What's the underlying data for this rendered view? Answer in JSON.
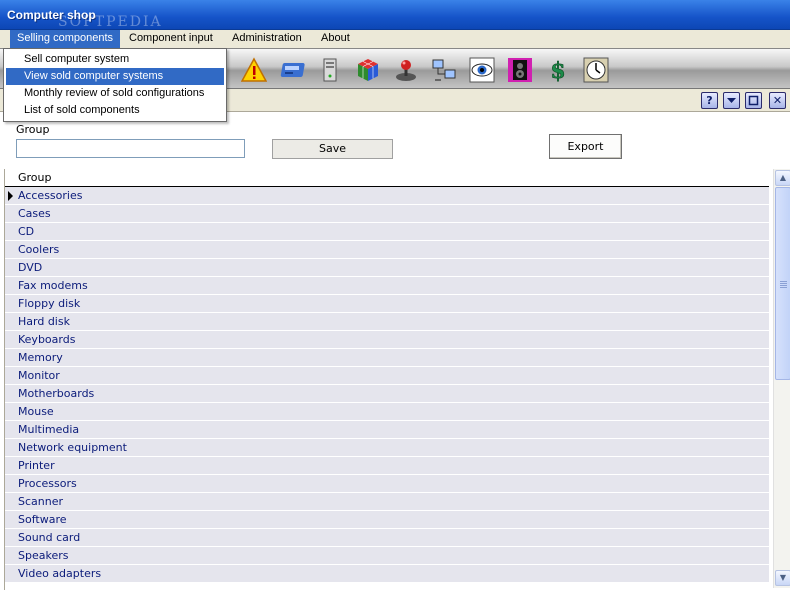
{
  "window": {
    "title": "Computer shop",
    "watermark": "SOFTPEDIA"
  },
  "menubar": {
    "items": [
      {
        "label": "Selling components",
        "active": true
      },
      {
        "label": "Component input"
      },
      {
        "label": "Administration"
      },
      {
        "label": "About"
      }
    ]
  },
  "dropdown": {
    "items": [
      {
        "label": "Sell computer system"
      },
      {
        "label": "View sold computer systems",
        "selected": true
      },
      {
        "label": "Monthly review of sold configurations"
      },
      {
        "label": "List of sold components"
      }
    ]
  },
  "toolbar": {
    "icons": [
      "warning-icon",
      "card-icon",
      "tower-computer-icon",
      "cube-icon",
      "joystick-icon",
      "network-icon",
      "eye-icon",
      "speaker-icon",
      "money-icon",
      "clock-icon"
    ]
  },
  "subbar": {
    "buttons": [
      "help-icon",
      "dropdown-icon",
      "restore-icon",
      "close-icon"
    ],
    "help_glyph": "?",
    "close_glyph": "✕"
  },
  "form": {
    "group_label": "Group",
    "group_value": "",
    "save_label": "Save",
    "export_label": "Export"
  },
  "grid": {
    "header": "Group",
    "current_row": 0,
    "rows": [
      "Accessories",
      "Cases",
      "CD",
      "Coolers",
      "DVD",
      "Fax modems",
      "Floppy disk",
      "Hard disk",
      "Keyboards",
      "Memory",
      "Monitor",
      "Motherboards",
      "Mouse",
      "Multimedia",
      "Network equipment",
      "Printer",
      "Processors",
      "Scanner",
      "Software",
      "Sound card",
      "Speakers",
      "Video adapters"
    ]
  },
  "colors": {
    "menu_highlight": "#316ac5",
    "row_bg": "#e5e5ed",
    "row_text": "#0b1b7a",
    "title_bar": "#1553c8"
  }
}
